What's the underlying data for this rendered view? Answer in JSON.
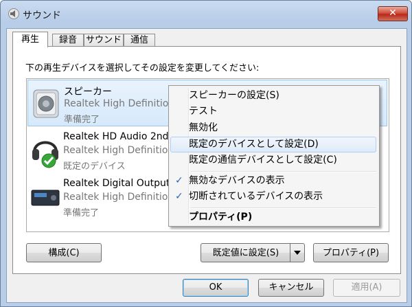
{
  "window": {
    "title": "サウンド",
    "close_label": "✕"
  },
  "tabs": [
    {
      "label": "再生"
    },
    {
      "label": "録音"
    },
    {
      "label": "サウンド"
    },
    {
      "label": "通信"
    }
  ],
  "instruction": "下の再生デバイスを選択してその設定を変更してください:",
  "devices": [
    {
      "name": "スピーカー",
      "driver": "Realtek High Definition",
      "status": "準備完了"
    },
    {
      "name": "Realtek HD Audio 2nd",
      "driver": "Realtek High Definition",
      "status": "既定のデバイス"
    },
    {
      "name": "Realtek Digital Output",
      "driver": "Realtek High Definition",
      "status": "準備完了"
    }
  ],
  "context_menu": {
    "items": [
      {
        "label": "スピーカーの設定(S)"
      },
      {
        "label": "テスト"
      },
      {
        "label": "無効化"
      },
      {
        "label": "既定のデバイスとして設定(D)"
      },
      {
        "label": "既定の通信デバイスとして設定(C)"
      },
      {
        "label": "無効なデバイスの表示"
      },
      {
        "label": "切断されているデバイスの表示"
      },
      {
        "label": "プロパティ(P)"
      }
    ],
    "check_glyph": "✓"
  },
  "buttons": {
    "configure": "構成(C)",
    "set_default": "既定値に設定(S)",
    "properties": "プロパティ(P)",
    "ok": "OK",
    "cancel": "キャンセル",
    "apply": "適用(A)"
  }
}
